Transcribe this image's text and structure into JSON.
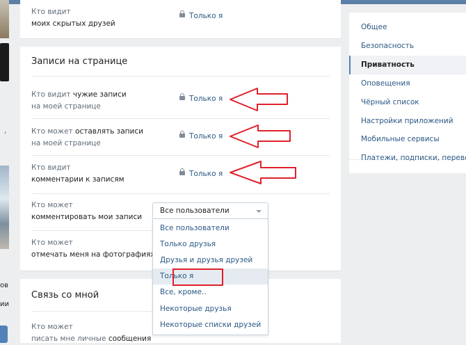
{
  "privacy": {
    "hidden_friends": {
      "label_line1": "Кто видит",
      "label_line2": "моих скрытых друзей",
      "value": "Только я"
    },
    "posts_section": {
      "title": "Записи на странице",
      "rows": [
        {
          "l1_prefix": "Кто видит ",
          "l1_bold": "чужие записи",
          "l1_suffix": "",
          "l2_prefix": "на моей странице",
          "l2_bold": "",
          "value": "Только я"
        },
        {
          "l1_prefix": "Кто может ",
          "l1_bold": "оставлять записи",
          "l1_suffix": "",
          "l2_prefix": "на моей странице",
          "l2_bold": "",
          "value": "Только я"
        },
        {
          "l1_prefix": "Кто видит",
          "l1_bold": "",
          "l1_suffix": "",
          "l2_prefix": "",
          "l2_bold": "комментарии к записям",
          "value": "Только я"
        },
        {
          "l1_prefix": "Кто может",
          "l1_bold": "",
          "l1_suffix": "",
          "l2_prefix": "",
          "l2_bold": "комментировать мои записи"
        },
        {
          "l1_prefix": "Кто может",
          "l1_bold": "",
          "l1_suffix": "",
          "l2_prefix": "",
          "l2_bold": "отмечать меня на фотографиях"
        }
      ],
      "select": {
        "selected": "Все пользователи",
        "options": [
          "Все пользователи",
          "Только друзья",
          "Друзья и друзья друзей",
          "Только я",
          "Все, кроме..",
          "Некоторые друзья",
          "Некоторые списки друзей"
        ],
        "highlighted_index": 3
      }
    },
    "contact_section": {
      "title": "Связь со мной",
      "row": {
        "l1_prefix": "Кто может",
        "l2_prefix": "писать мне личные ",
        "l2_bold": "сообщения"
      }
    }
  },
  "settings_menu": {
    "items": [
      {
        "label": "Общее"
      },
      {
        "label": "Безопасность"
      },
      {
        "label": "Приватность",
        "active": true
      },
      {
        "label": "Оповещения"
      },
      {
        "label": "Чёрный список"
      },
      {
        "label": "Настройки приложений"
      },
      {
        "label": "Мобильные сервисы"
      },
      {
        "label": "Платежи, подписки, переводы"
      }
    ]
  },
  "left_strip": {
    "text1": "ов",
    "text2": "ии"
  },
  "colors": {
    "link": "#2a5885",
    "annotation": "#e0202a",
    "accent": "#5181b8"
  }
}
